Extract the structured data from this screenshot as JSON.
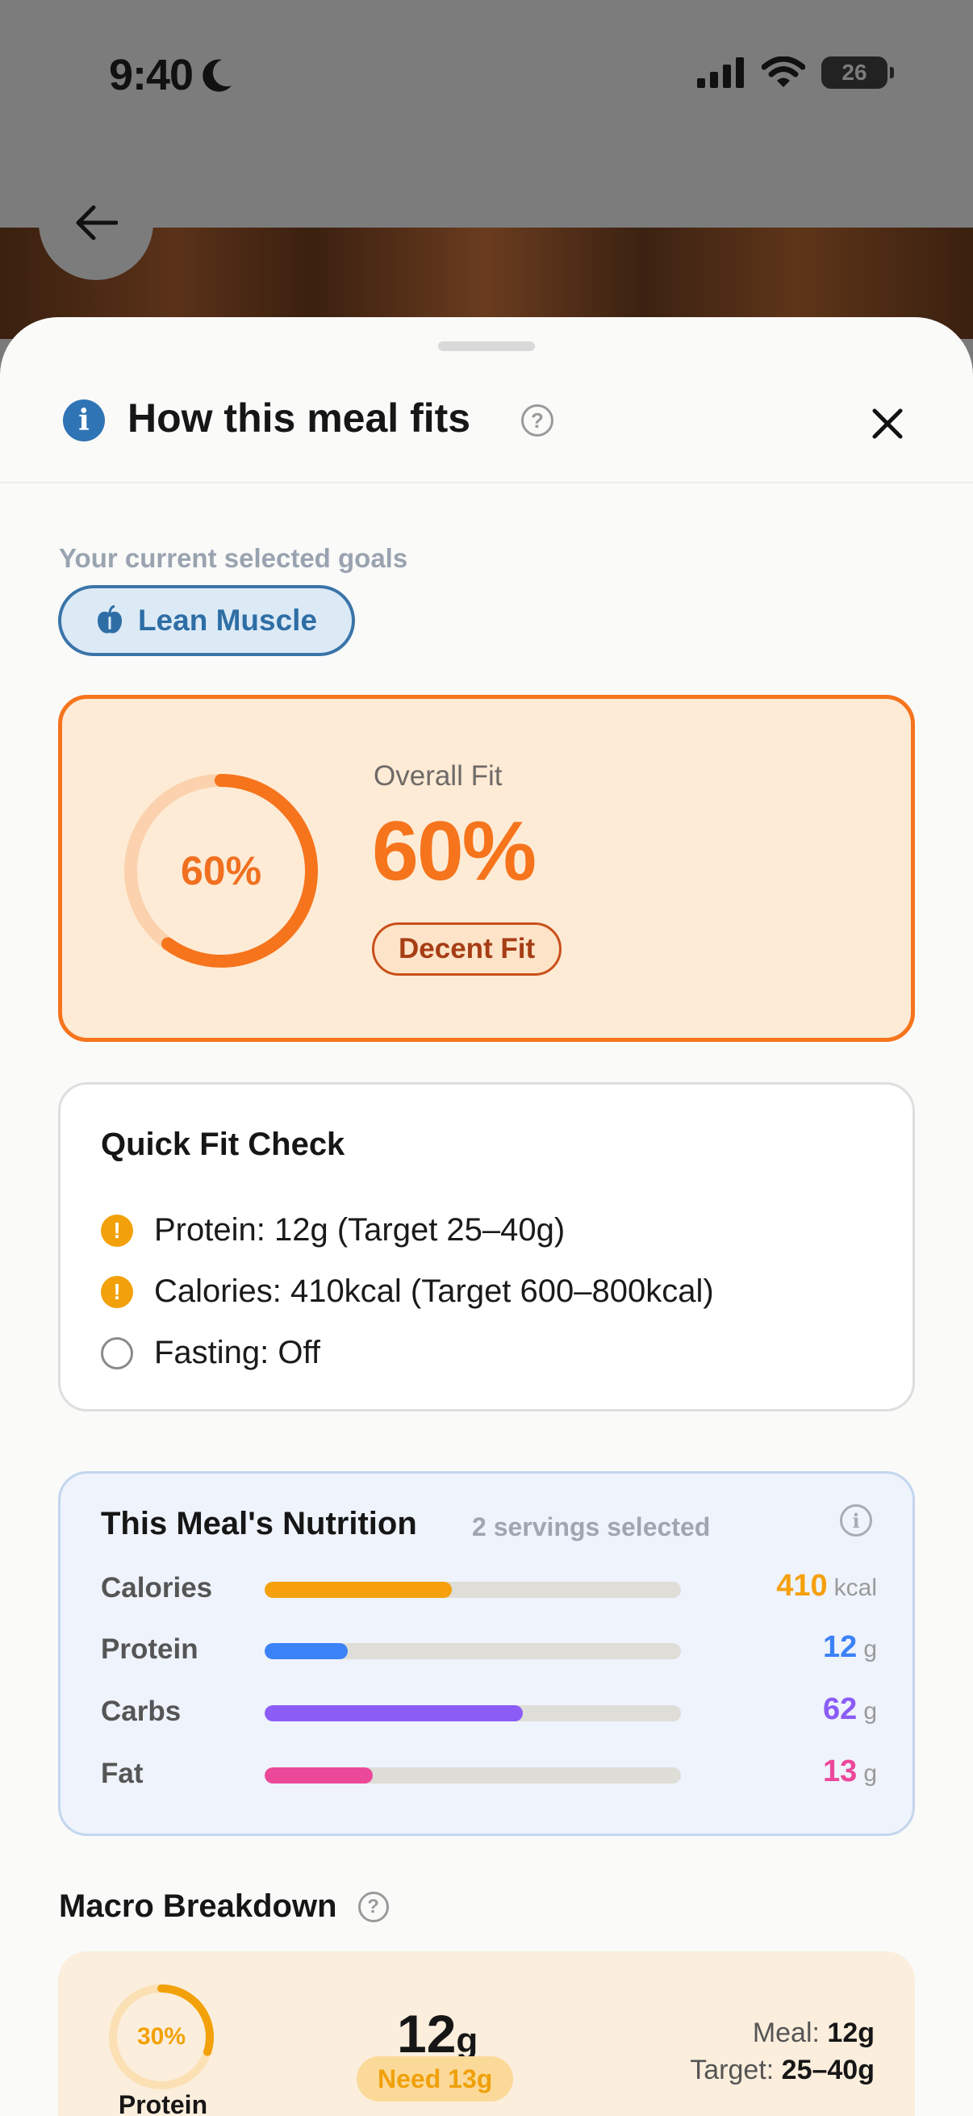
{
  "status_bar": {
    "time": "9:40",
    "battery": "26"
  },
  "header": {
    "title": "How this meal fits"
  },
  "goals": {
    "label": "Your current selected goals",
    "chip": "Lean Muscle"
  },
  "overall_fit": {
    "ring_label": "60%",
    "label": "Overall Fit",
    "value": "60%",
    "badge": "Decent Fit",
    "percent": 60
  },
  "quick_check": {
    "title": "Quick Fit Check",
    "items": [
      {
        "text": "Protein: 12g (Target 25–40g)",
        "status": "warning"
      },
      {
        "text": "Calories: 410kcal (Target 600–800kcal)",
        "status": "warning"
      },
      {
        "text": "Fasting: Off",
        "status": "off"
      }
    ]
  },
  "nutrition": {
    "title": "This Meal's Nutrition",
    "subtitle": "2 servings selected",
    "rows": [
      {
        "name": "Calories",
        "value": "410",
        "unit": "kcal",
        "fill": 0.45,
        "color": "#f5a00c"
      },
      {
        "name": "Protein",
        "value": "12",
        "unit": "g",
        "fill": 0.2,
        "color": "#3b82f6"
      },
      {
        "name": "Carbs",
        "value": "62",
        "unit": "g",
        "fill": 0.62,
        "color": "#8b5cf6"
      },
      {
        "name": "Fat",
        "value": "13",
        "unit": "g",
        "fill": 0.26,
        "color": "#ec4899"
      }
    ]
  },
  "macro": {
    "title": "Macro Breakdown",
    "protein": {
      "ring_label": "30%",
      "percent": 30,
      "name": "Protein",
      "amount": "12",
      "amount_unit": "g",
      "need": "Need 13g",
      "meal_label": "Meal:",
      "meal_value": "12g",
      "target_label": "Target:",
      "target_value": "25–40g"
    }
  },
  "colors": {
    "accent": "#f6741c",
    "info": "#2f74b5",
    "warning": "#f2a10a"
  }
}
